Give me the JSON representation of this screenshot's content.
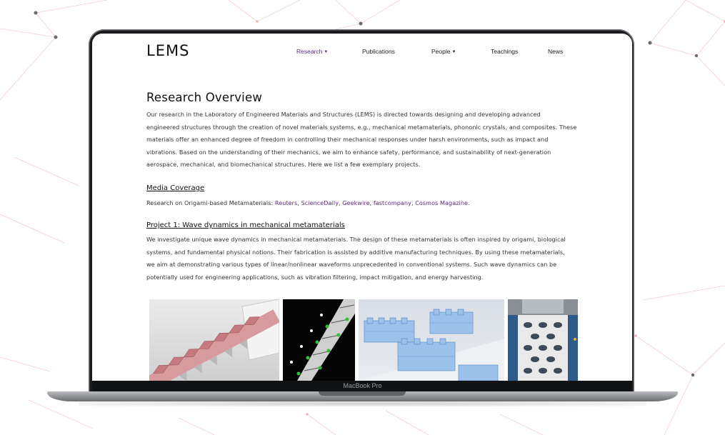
{
  "device": {
    "label": "MacBook Pro"
  },
  "site": {
    "logo": "LEMS",
    "nav": [
      {
        "label": "Research",
        "has_caret": true,
        "active": true
      },
      {
        "label": "Publications",
        "has_caret": false,
        "active": false
      },
      {
        "label": "People",
        "has_caret": true,
        "active": false
      },
      {
        "label": "Teachings",
        "has_caret": false,
        "active": false
      },
      {
        "label": "News",
        "has_caret": false,
        "active": false
      }
    ],
    "accent_color": "#5b2a86"
  },
  "overview": {
    "title": "Research Overview",
    "lines": [
      "Our research in the Laboratory of Engineered Materials and Structures (LEMS) is directed towards designing and developing advanced",
      "engineered structures through the creation of novel materials systems, e.g., mechanical metamaterials, phononic crystals, and composites. These",
      "materials offer an enhanced degree of freedom in controlling their mechanical responses under harsh environments, such as impact and",
      "vibrations. Based on the understanding of their mechanics, we aim to enhance safety, performance, and sustainability of next-generation",
      "aerospace, mechanical, and biomechanical structures. Here we list a few exemplary projects."
    ]
  },
  "media": {
    "title": "Media Coverage",
    "prefix": "Research on Origami-based Metamaterials: ",
    "links": [
      "Reuters",
      "ScienceDaily",
      "Geekwire",
      "fastcompany",
      "Cosmos Magazine."
    ]
  },
  "project1": {
    "title": "Project 1: Wave dynamics in mechanical metamaterials",
    "lines": [
      "We investigate unique wave dynamics in mechanical metamaterials. The design of these metamaterials is often inspired by origami, biological",
      "systems, and fundamental physical notions. Their fabrication is assisted by additive manufacturing techniques. By using these metamaterials,",
      "we aim at demonstrating various types of linear/nonlinear waveforms unprecedented in conventional systems. Such wave dynamics can be",
      "potentially used for engineering applications, such as vibration filtering, impact mitigation, and energy harvesting."
    ]
  }
}
